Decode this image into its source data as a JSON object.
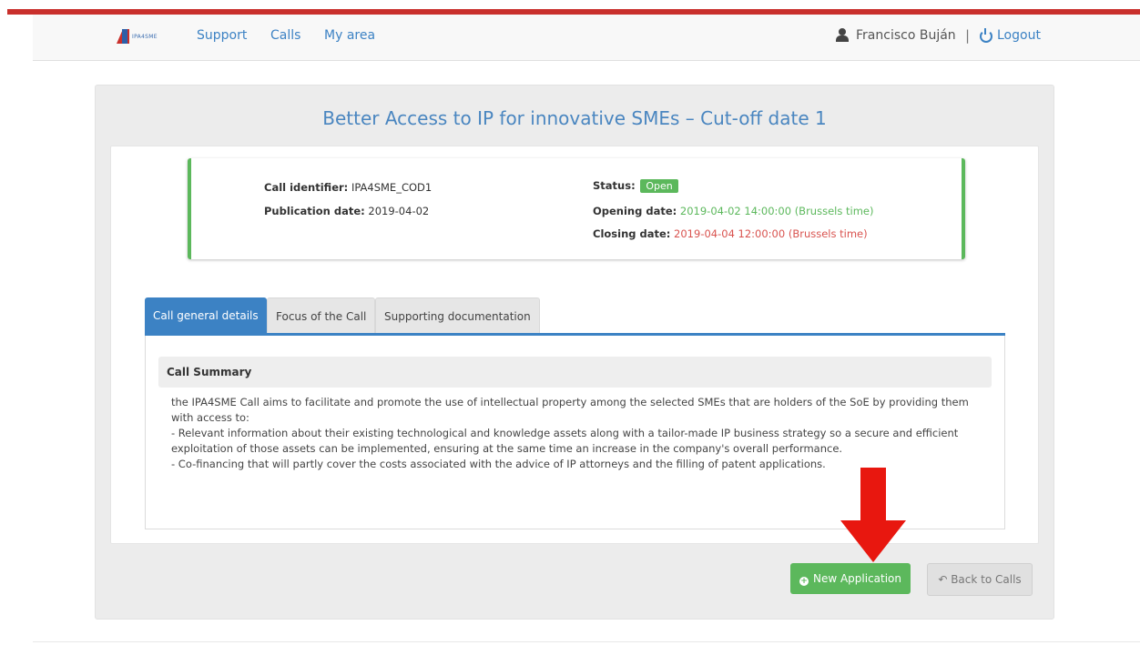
{
  "nav": {
    "logo_text": "IPA4SME",
    "links": [
      "Support",
      "Calls",
      "My area"
    ],
    "user_name": "Francisco Buján",
    "separator": "|",
    "logout": "Logout"
  },
  "page": {
    "title": "Better Access to IP for innovative SMEs – Cut-off date 1"
  },
  "call_info": {
    "identifier_label": "Call identifier:",
    "identifier_value": "IPA4SME_COD1",
    "publication_label": "Publication date:",
    "publication_value": "2019-04-02",
    "status_label": "Status:",
    "status_value": "Open",
    "opening_label": "Opening date:",
    "opening_value": "2019-04-02 14:00:00 (Brussels time)",
    "closing_label": "Closing date:",
    "closing_value": "2019-04-04 12:00:00 (Brussels time)"
  },
  "tabs": [
    "Call general details",
    "Focus of the Call",
    "Supporting documentation"
  ],
  "summary": {
    "heading": "Call Summary",
    "lines": [
      "the IPA4SME Call aims to facilitate and promote the use of intellectual property among the selected SMEs that are holders of the SoE by providing them",
      "with access to:",
      "- Relevant information about their existing technological and knowledge assets along with a tailor-made IP business strategy so a secure and efficient",
      "exploitation of those assets can be implemented, ensuring at the same time an increase in the company's overall performance.",
      "- Co-financing that will partly cover the costs associated with the advice of IP attorneys and the filling of patent applications."
    ]
  },
  "actions": {
    "new_application": "New Application",
    "back_to_calls": "Back to Calls"
  },
  "colors": {
    "accent": "#3c82c4",
    "success": "#5cb85c",
    "danger": "#d9534f",
    "arrow": "#e8170f"
  }
}
